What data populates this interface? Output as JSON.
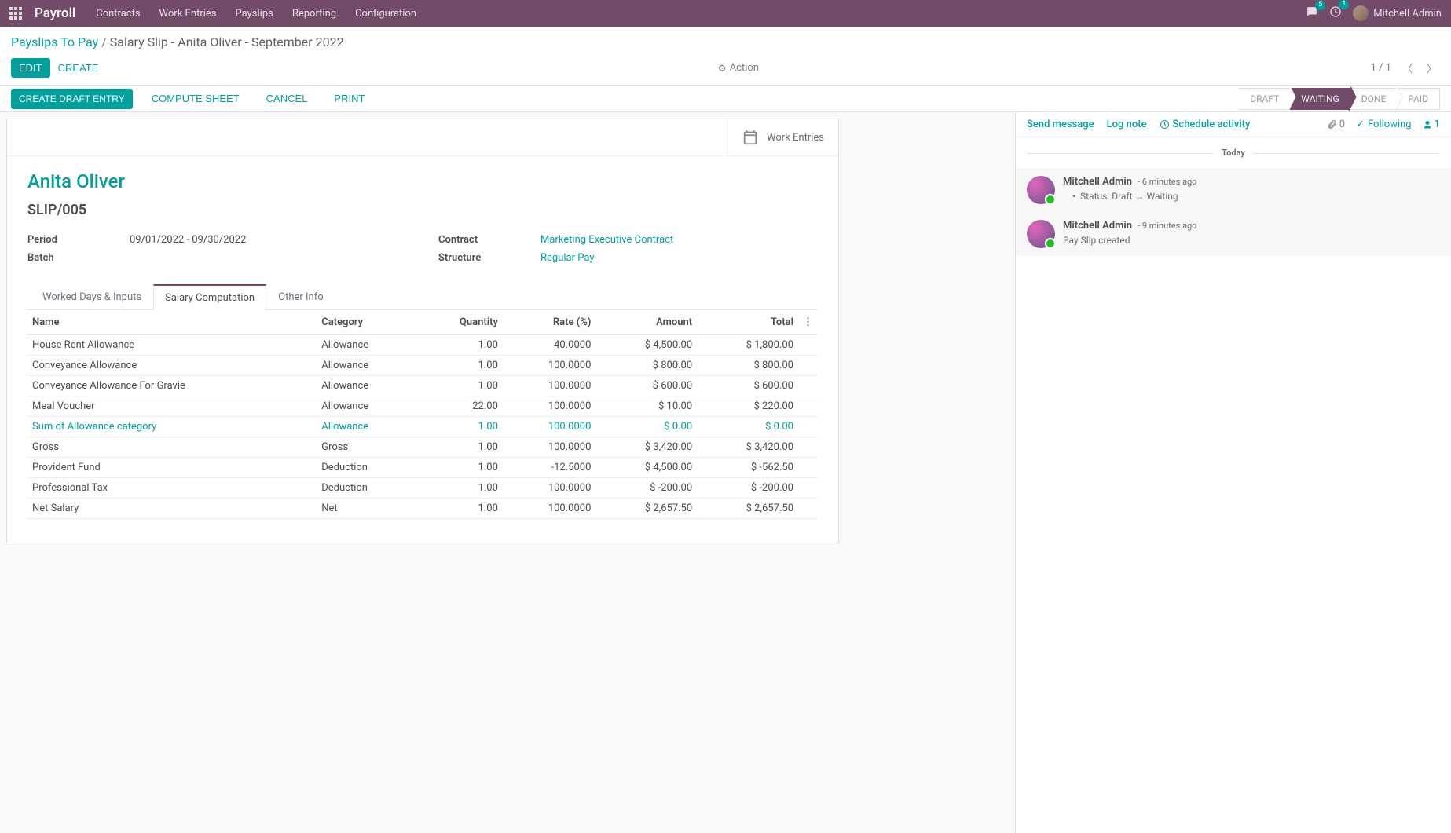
{
  "navbar": {
    "brand": "Payroll",
    "menu": [
      "Contracts",
      "Work Entries",
      "Payslips",
      "Reporting",
      "Configuration"
    ],
    "msg_count": "5",
    "clock_count": "1",
    "user": "Mitchell Admin"
  },
  "breadcrumb": {
    "parent": "Payslips To Pay",
    "current": "Salary Slip - Anita Oliver - September 2022"
  },
  "buttons": {
    "edit": "EDIT",
    "create": "CREATE",
    "action": "Action",
    "pager": "1 / 1",
    "create_draft": "CREATE DRAFT ENTRY",
    "compute": "COMPUTE SHEET",
    "cancel": "CANCEL",
    "print": "PRINT"
  },
  "status_steps": [
    "DRAFT",
    "WAITING",
    "DONE",
    "PAID"
  ],
  "stat": {
    "work_entries": "Work Entries"
  },
  "record": {
    "employee": "Anita Oliver",
    "slip": "SLIP/005",
    "period_label": "Period",
    "period": "09/01/2022 - 09/30/2022",
    "batch_label": "Batch",
    "batch": "",
    "contract_label": "Contract",
    "contract": "Marketing Executive Contract",
    "structure_label": "Structure",
    "structure": "Regular Pay"
  },
  "tabs": [
    "Worked Days & Inputs",
    "Salary Computation",
    "Other Info"
  ],
  "table": {
    "headers": [
      "Name",
      "Category",
      "Quantity",
      "Rate (%)",
      "Amount",
      "Total"
    ],
    "rows": [
      {
        "name": "House Rent Allowance",
        "category": "Allowance",
        "qty": "1.00",
        "rate": "40.0000",
        "amount": "$ 4,500.00",
        "total": "$ 1,800.00",
        "link": false
      },
      {
        "name": "Conveyance Allowance",
        "category": "Allowance",
        "qty": "1.00",
        "rate": "100.0000",
        "amount": "$ 800.00",
        "total": "$ 800.00",
        "link": false
      },
      {
        "name": "Conveyance Allowance For Gravie",
        "category": "Allowance",
        "qty": "1.00",
        "rate": "100.0000",
        "amount": "$ 600.00",
        "total": "$ 600.00",
        "link": false
      },
      {
        "name": "Meal Voucher",
        "category": "Allowance",
        "qty": "22.00",
        "rate": "100.0000",
        "amount": "$ 10.00",
        "total": "$ 220.00",
        "link": false
      },
      {
        "name": "Sum of Allowance category",
        "category": "Allowance",
        "qty": "1.00",
        "rate": "100.0000",
        "amount": "$ 0.00",
        "total": "$ 0.00",
        "link": true
      },
      {
        "name": "Gross",
        "category": "Gross",
        "qty": "1.00",
        "rate": "100.0000",
        "amount": "$ 3,420.00",
        "total": "$ 3,420.00",
        "link": false
      },
      {
        "name": "Provident Fund",
        "category": "Deduction",
        "qty": "1.00",
        "rate": "-12.5000",
        "amount": "$ 4,500.00",
        "total": "$ -562.50",
        "link": false
      },
      {
        "name": "Professional Tax",
        "category": "Deduction",
        "qty": "1.00",
        "rate": "100.0000",
        "amount": "$ -200.00",
        "total": "$ -200.00",
        "link": false
      },
      {
        "name": "Net Salary",
        "category": "Net",
        "qty": "1.00",
        "rate": "100.0000",
        "amount": "$ 2,657.50",
        "total": "$ 2,657.50",
        "link": false
      }
    ]
  },
  "chatter": {
    "send": "Send message",
    "lognote": "Log note",
    "schedule": "Schedule activity",
    "attach": "0",
    "following": "Following",
    "followers": "1",
    "today": "Today",
    "msgs": [
      {
        "author": "Mitchell Admin",
        "time": "- 6 minutes ago",
        "type": "status",
        "status_label": "Status:",
        "from": "Draft",
        "to": "Waiting"
      },
      {
        "author": "Mitchell Admin",
        "time": "- 9 minutes ago",
        "type": "text",
        "text": "Pay Slip created"
      }
    ]
  }
}
